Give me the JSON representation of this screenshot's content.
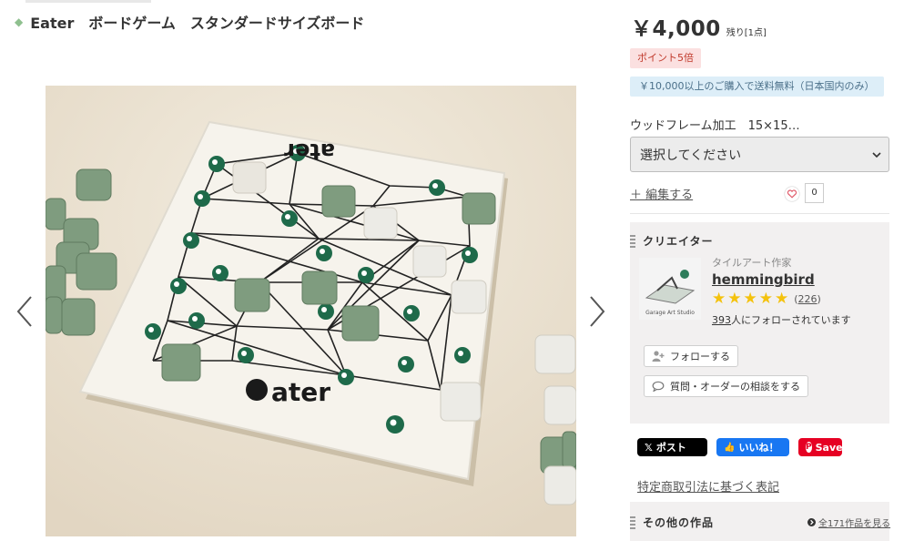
{
  "product": {
    "title": "Eater　ボードゲーム　スタンダードサイズボード",
    "price": "￥4,000",
    "stock": "残り[1点]",
    "points_badge": "ポイント5倍",
    "shipping_badge": "￥10,000以上のご購入で送料無料（日本国内のみ）",
    "option_label": "ウッドフレーム加工　15×15…",
    "option_selected": "選択してください",
    "edit_label": "＋ 編集する",
    "favorite_count": "0"
  },
  "photo": {
    "board_logo_bottom": "ater",
    "board_logo_top": "ater"
  },
  "creator": {
    "heading": "クリエイター",
    "type": "タイルアート作家",
    "name": "hemmingbird",
    "rating_stars": 5,
    "review_count": "226",
    "followers_count": "393",
    "followers_suffix": "人にフォローされています",
    "avatar_caption": "Garage Art Studio",
    "follow_label": "フォローする",
    "consult_label": "質問・オーダーの相談をする"
  },
  "share": {
    "x_label": "ポスト",
    "facebook_label": "いいね！",
    "pinterest_label": "Save"
  },
  "law_link": "特定商取引法に基づく表記",
  "other_works": {
    "heading": "その他の作品",
    "all_link": "全171作品を見る"
  },
  "colors": {
    "accent_green": "#2e7d5b",
    "price_badge_bg": "#fbe0e0",
    "shipping_badge_bg": "#ddeef8",
    "star": "#f4c20d"
  }
}
